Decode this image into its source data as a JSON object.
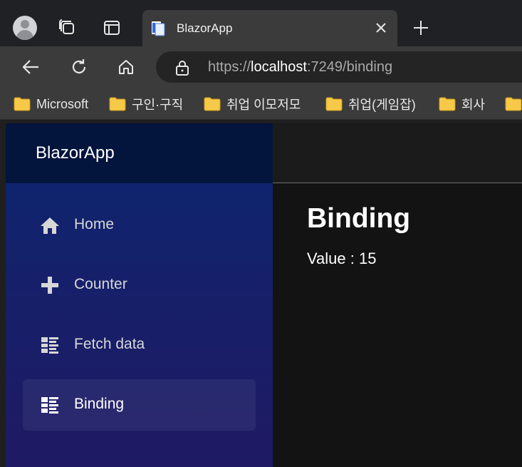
{
  "browser": {
    "tab": {
      "title": "BlazorApp"
    },
    "address": {
      "scheme": "https://",
      "host": "localhost",
      "rest": ":7249/binding"
    },
    "bookmarks": [
      {
        "label": "Microsoft"
      },
      {
        "label": "구인·구직"
      },
      {
        "label": "취업 이모저모"
      },
      {
        "label": "취업(게임잡)"
      },
      {
        "label": "회사"
      }
    ]
  },
  "app": {
    "brand": "BlazorApp",
    "nav": [
      {
        "label": "Home",
        "icon": "home-icon"
      },
      {
        "label": "Counter",
        "icon": "plus-icon"
      },
      {
        "label": "Fetch data",
        "icon": "list-icon"
      },
      {
        "label": "Binding",
        "icon": "list-icon",
        "active": true
      }
    ],
    "content": {
      "title": "Binding",
      "value_text": "Value : 15"
    }
  },
  "colors": {
    "sidebar_top": "#0a2770",
    "sidebar_bottom": "#1f1a63",
    "brandbar": "#03143d",
    "folder": "#f7c948"
  }
}
